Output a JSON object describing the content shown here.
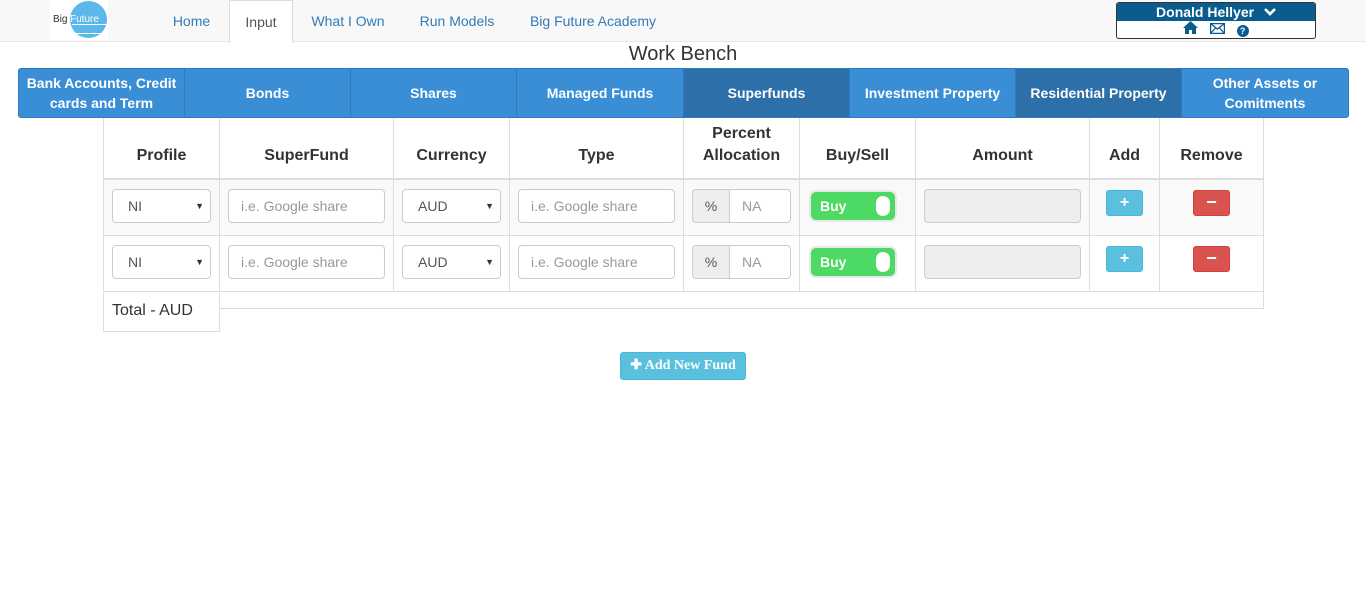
{
  "logo": {
    "text_left": "Big",
    "text_right": "Future"
  },
  "nav": {
    "items": [
      {
        "label": "Home"
      },
      {
        "label": "Input"
      },
      {
        "label": "What I Own"
      },
      {
        "label": "Run Models"
      },
      {
        "label": "Big Future Academy"
      }
    ],
    "active": "Input"
  },
  "user": {
    "name": "Donald Hellyer",
    "menu_icon": "chevron-down-icon",
    "icons": [
      "home-icon",
      "mail-icon",
      "help-icon"
    ]
  },
  "page": {
    "title": "Work Bench"
  },
  "asset_tabs": [
    {
      "label": "Bank Accounts, Credit cards and Term"
    },
    {
      "label": "Bonds"
    },
    {
      "label": "Shares"
    },
    {
      "label": "Managed Funds"
    },
    {
      "label": "Superfunds",
      "active": true
    },
    {
      "label": "Investment Property"
    },
    {
      "label": "Residential Property"
    },
    {
      "label": "Other Assets or Comitments"
    }
  ],
  "table": {
    "headers": {
      "profile": "Profile",
      "superfund": "SuperFund",
      "currency": "Currency",
      "type": "Type",
      "percent": "Percent Allocation",
      "buysell": "Buy/Sell",
      "amount": "Amount",
      "add": "Add",
      "remove": "Remove"
    },
    "rows": [
      {
        "profile": "NI",
        "superfund_placeholder": "i.e. Google share",
        "currency": "AUD",
        "type_placeholder": "i.e. Google share",
        "pct_addon": "%",
        "pct_placeholder": "NA",
        "buysell": "Buy",
        "add": "+",
        "remove": "−"
      },
      {
        "profile": "NI",
        "superfund_placeholder": "i.e. Google share",
        "currency": "AUD",
        "type_placeholder": "i.e. Google share",
        "pct_addon": "%",
        "pct_placeholder": "NA",
        "buysell": "Buy",
        "add": "+",
        "remove": "−"
      }
    ],
    "total_label": "Total - AUD"
  },
  "add_fund_button": "✚ Add New Fund",
  "colors": {
    "primary_tab": "#3a8ed6",
    "buy_toggle": "#4cd964",
    "add": "#5bc0de",
    "remove": "#d9534f"
  }
}
